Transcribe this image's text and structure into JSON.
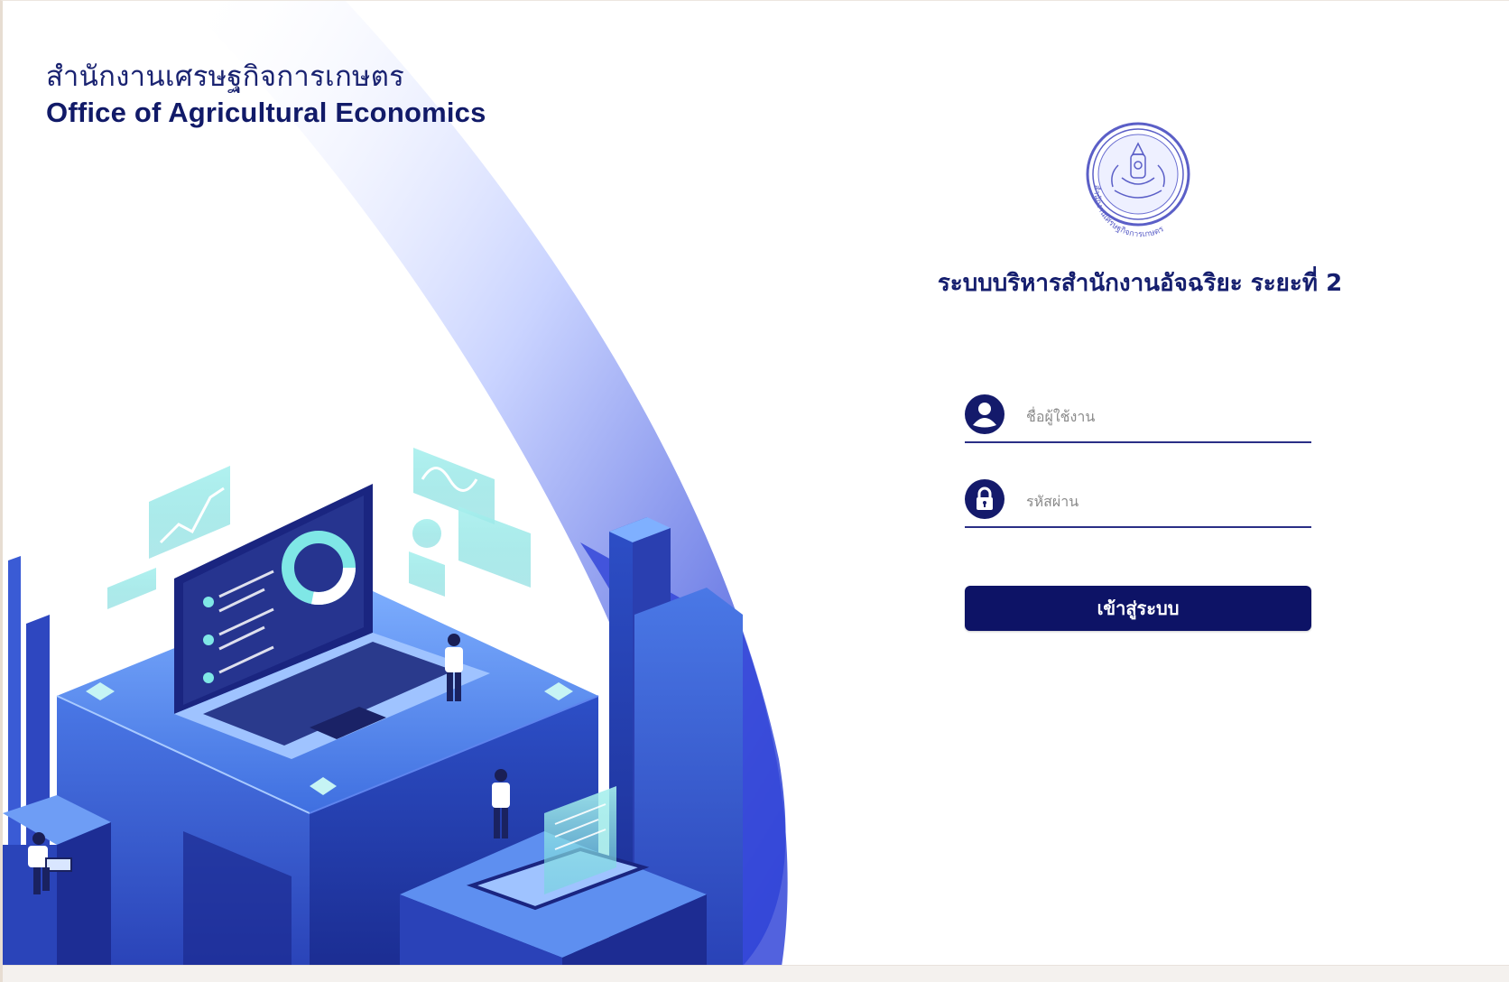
{
  "brand": {
    "thai_name": "สำนักงานเศรษฐกิจการเกษตร",
    "english_name": "Office of Agricultural Economics"
  },
  "seal": {
    "icon": "oae-seal-icon",
    "ring_text": "สำนักงานเศรษฐกิจการเกษตร"
  },
  "login": {
    "title": "ระบบบริหารสำนักงานอัจฉริยะ ระยะที่ 2",
    "username": {
      "placeholder": "ชื่อผู้ใช้งาน",
      "value": "",
      "icon": "user-icon"
    },
    "password": {
      "placeholder": "รหัสผ่าน",
      "value": "",
      "icon": "lock-icon"
    },
    "submit_label": "เข้าสู่ระบบ"
  },
  "colors": {
    "primary": "#0d1366",
    "accent": "#3b5bdb",
    "seal": "#5b5fc7"
  }
}
